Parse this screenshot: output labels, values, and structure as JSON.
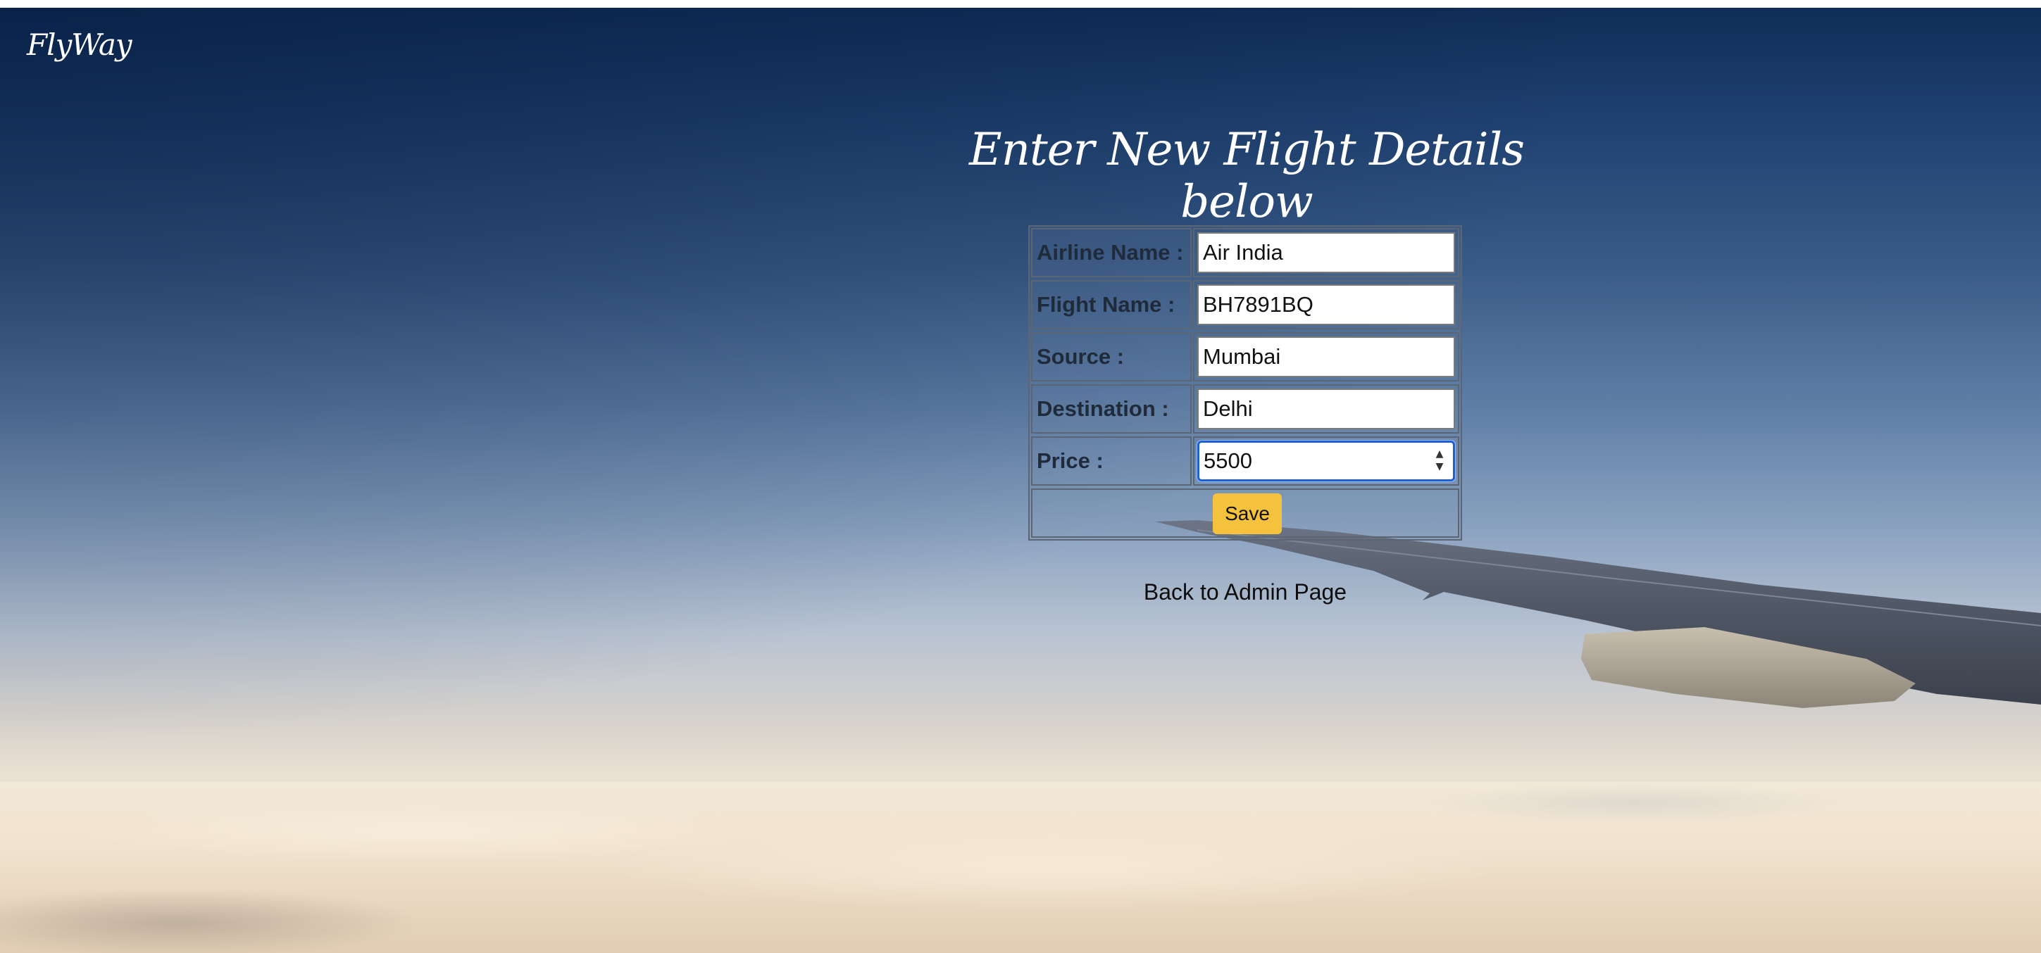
{
  "brand": {
    "name": "FlyWay"
  },
  "page": {
    "heading": "Enter New Flight Details below"
  },
  "form": {
    "fields": [
      {
        "label": "Airline Name :",
        "value": "Air India"
      },
      {
        "label": "Flight Name :",
        "value": "BH7891BQ"
      },
      {
        "label": "Source :",
        "value": "Mumbai"
      },
      {
        "label": "Destination :",
        "value": "Delhi"
      },
      {
        "label": "Price :",
        "value": "5500"
      }
    ],
    "save_label": "Save"
  },
  "links": {
    "back_to_admin": "Back to Admin Page"
  },
  "colors": {
    "save_button": "#f5c23d",
    "focus_ring": "#1f5fd6",
    "heading_text": "#ffffff"
  },
  "icons": {
    "spinner": "number-spinner-icon"
  }
}
